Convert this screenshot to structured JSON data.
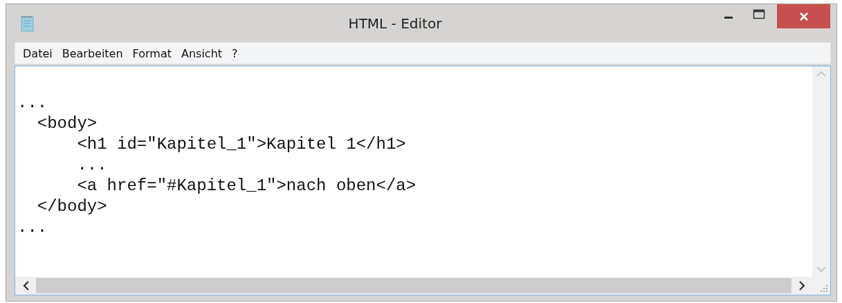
{
  "window": {
    "title": "HTML - Editor"
  },
  "menu": [
    "Datei",
    "Bearbeiten",
    "Format",
    "Ansicht",
    "?"
  ],
  "editor": {
    "lines": [
      "...",
      "  <body>",
      "      <h1 id=\"Kapitel_1\">Kapitel 1</h1>",
      "      ...",
      "      <a href=\"#Kapitel_1\">nach oben</a>",
      "  </body>",
      "..."
    ]
  }
}
